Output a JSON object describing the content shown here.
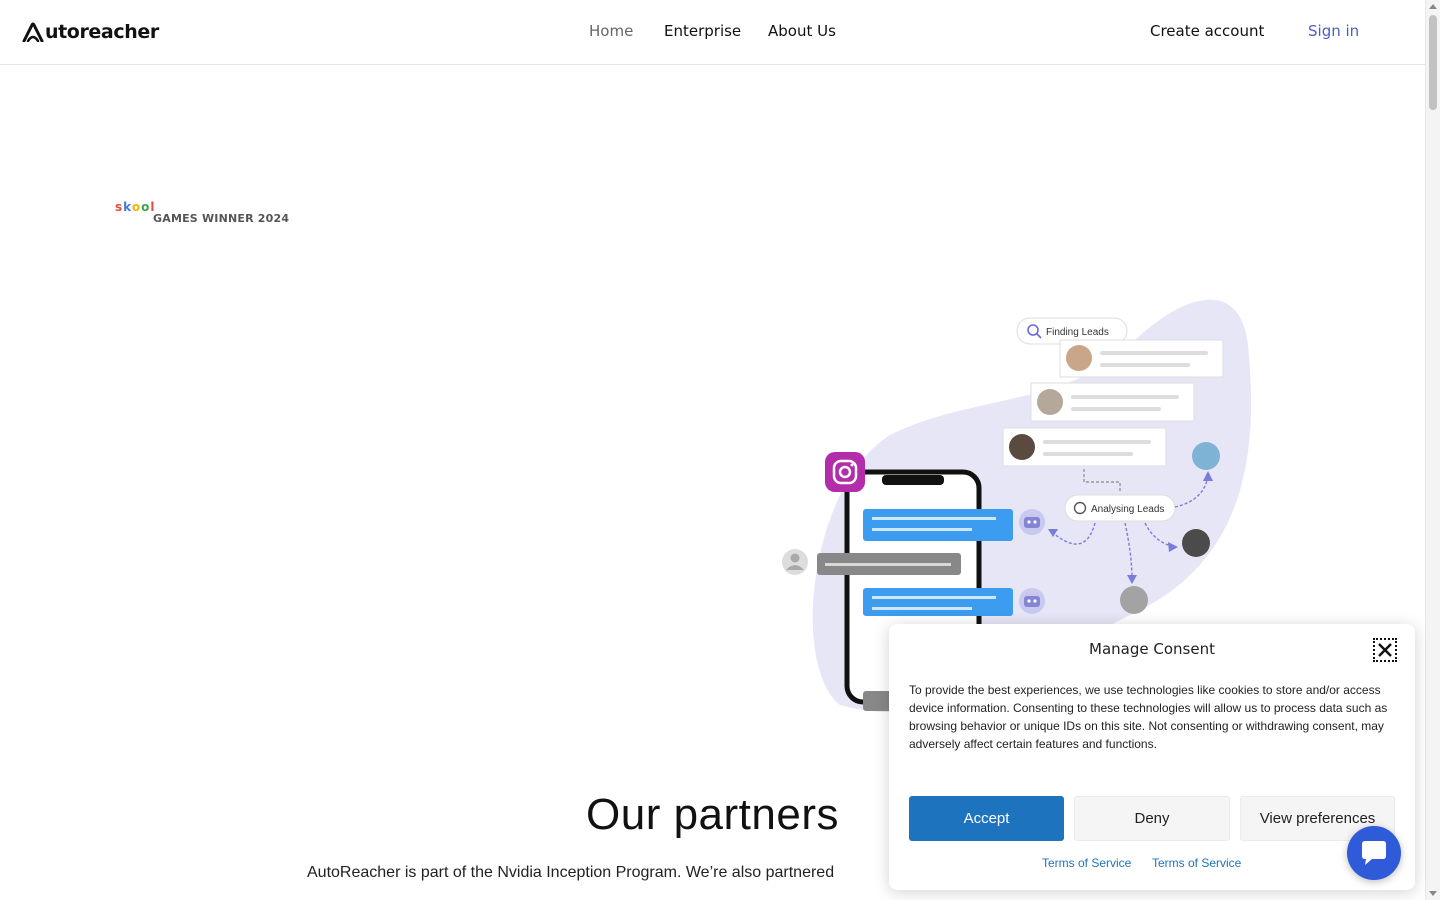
{
  "header": {
    "logo_text": "utoreacher",
    "nav": {
      "home": "Home",
      "enterprise": "Enterprise",
      "about": "About Us",
      "create_account": "Create account",
      "sign_in": "Sign in"
    }
  },
  "badge": {
    "skool_letters": [
      "s",
      "k",
      "o",
      "o",
      "l"
    ],
    "skool_colors": [
      "#e84b3c",
      "#3b7ddd",
      "#f5b400",
      "#34a853",
      "#e84b3c"
    ],
    "subtitle": "GAMES WINNER 2024"
  },
  "illustration": {
    "finding_leads": "Finding Leads",
    "analysing_leads": "Analysing Leads",
    "blob_color": "#e6e6f7",
    "chat_blue": "#3b9cf0",
    "chat_gray": "#888888"
  },
  "partners": {
    "title": "Our partners",
    "text": "AutoReacher is part of the Nvidia Inception Program. We’re also partnered"
  },
  "consent": {
    "title": "Manage Consent",
    "body": "To provide the best experiences, we use technologies like cookies to store and/or access device information. Consenting to these technologies will allow us to process data such as browsing behavior or unique IDs on this site. Not consenting or withdrawing consent, may adversely affect certain features and functions.",
    "accept": "Accept",
    "deny": "Deny",
    "preferences": "View preferences",
    "link_1": "Terms of Service",
    "link_2": "Terms of Service",
    "accent": "#1e73be"
  }
}
